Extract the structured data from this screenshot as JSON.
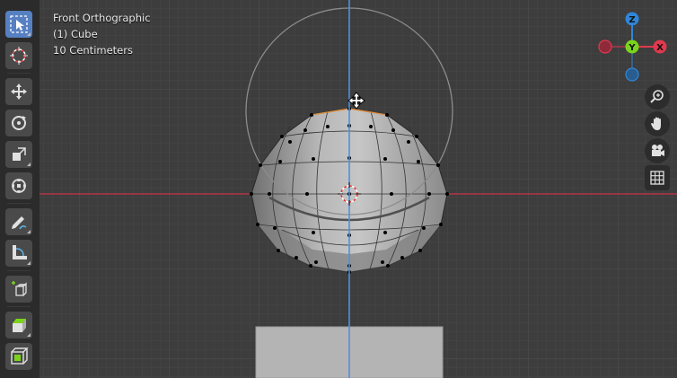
{
  "viewport": {
    "view_name": "Front Orthographic",
    "object_name": "(1) Cube",
    "scale_label": "10 Centimeters"
  },
  "gizmo": {
    "z_label": "Z",
    "y_label": "Y",
    "x_label": "X",
    "colors": {
      "x": "#e0394e",
      "y": "#7bd41c",
      "z": "#2f86d8"
    }
  },
  "toolbar": {
    "tools": [
      {
        "name": "select-box-tool",
        "icon": "select-box-icon",
        "active": true
      },
      {
        "name": "cursor-tool",
        "icon": "cursor-icon",
        "active": false
      },
      {
        "name": "move-tool",
        "icon": "move-icon",
        "active": false
      },
      {
        "name": "rotate-tool",
        "icon": "rotate-icon",
        "active": false
      },
      {
        "name": "scale-tool",
        "icon": "scale-icon",
        "active": false
      },
      {
        "name": "transform-tool",
        "icon": "transform-icon",
        "active": false
      },
      {
        "name": "annotate-tool",
        "icon": "annotate-icon",
        "active": false
      },
      {
        "name": "measure-tool",
        "icon": "measure-icon",
        "active": false
      },
      {
        "name": "add-cube-tool",
        "icon": "add-cube-icon",
        "active": false
      },
      {
        "name": "extrude-tool",
        "icon": "extrude-icon",
        "active": false
      },
      {
        "name": "inset-tool",
        "icon": "inset-icon",
        "active": false
      }
    ]
  },
  "navigation": {
    "buttons": [
      "zoom-icon",
      "hand-icon",
      "camera-icon",
      "grid-icon"
    ]
  },
  "colors": {
    "x_axis": "#c8324a",
    "z_axis": "#4f8fe0",
    "vertex": "#000000",
    "selection_edge": "#e8913a"
  }
}
